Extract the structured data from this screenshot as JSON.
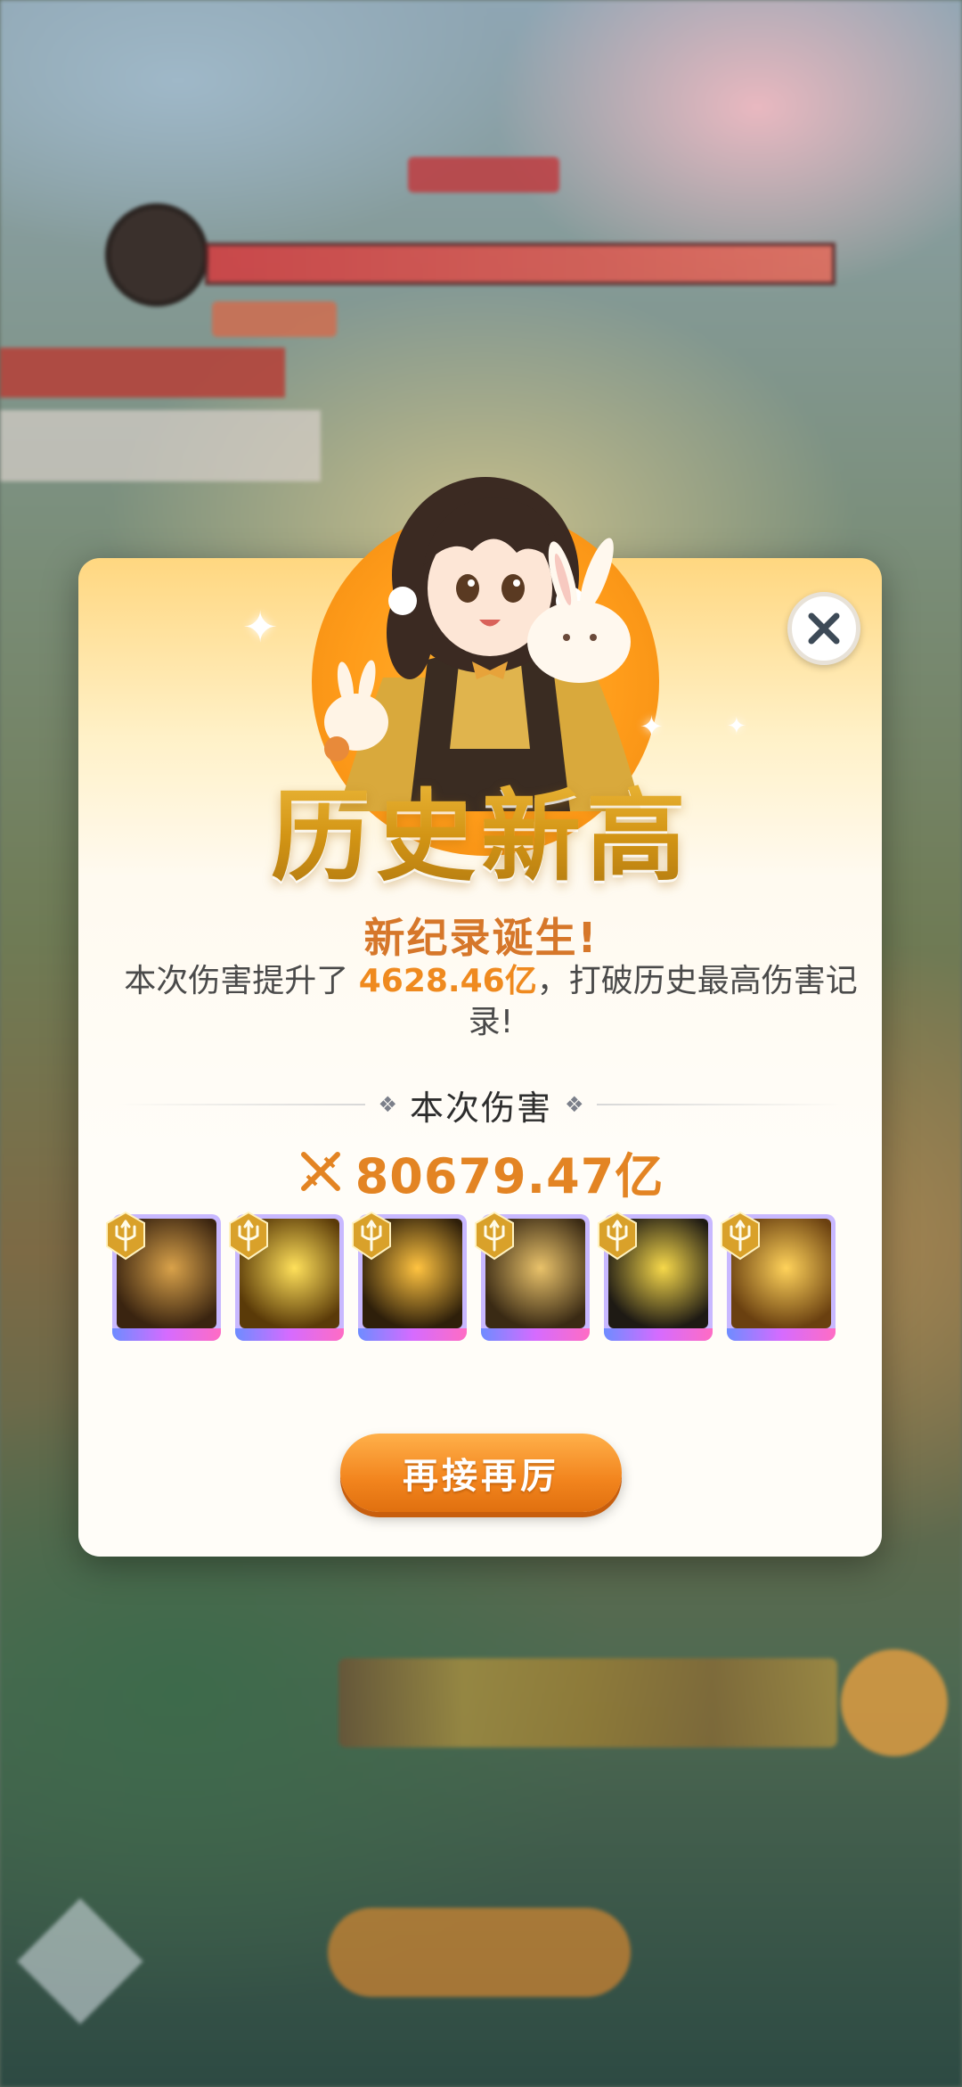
{
  "dialog": {
    "title": "历史新高",
    "subtitle": "新纪录诞生!",
    "desc_prefix": "本次伤害提升了 ",
    "desc_highlight": "4628.46亿",
    "desc_suffix": "，打破历史最高伤害记录!",
    "section_label": "本次伤害",
    "damage_value": "80679.47亿",
    "button_label": "再接再厉",
    "close_icon": "close-icon",
    "damage_icon": "crossed-swords-icon"
  },
  "skills": [
    {
      "name": "skill-blades",
      "art_colors": [
        "#3a2410",
        "#d9a24a"
      ]
    },
    {
      "name": "skill-burst",
      "art_colors": [
        "#5a3a08",
        "#ffe05a"
      ]
    },
    {
      "name": "skill-swirl",
      "art_colors": [
        "#2e1f0a",
        "#ffc340"
      ]
    },
    {
      "name": "skill-dragon",
      "art_colors": [
        "#3a2a14",
        "#e9c26a"
      ]
    },
    {
      "name": "skill-strike",
      "art_colors": [
        "#1e1a14",
        "#f6d84a"
      ]
    },
    {
      "name": "skill-dancer",
      "art_colors": [
        "#6a4010",
        "#ffd25a"
      ]
    }
  ],
  "colors": {
    "accent_orange": "#ef8a1f",
    "title_gold": "#d39515",
    "skill_frame": "#d56bff"
  }
}
